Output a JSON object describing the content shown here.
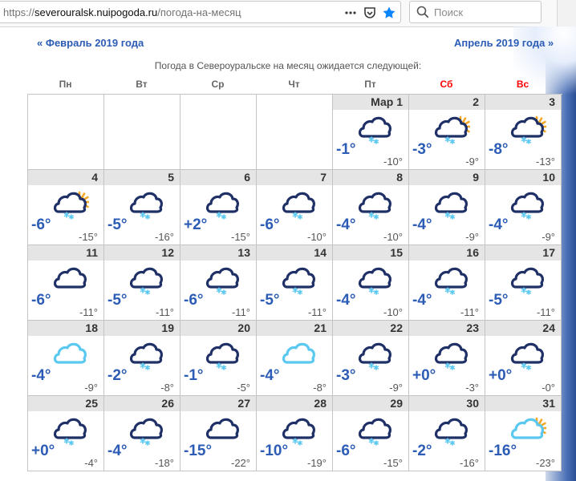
{
  "browser": {
    "url_prefix": "https://",
    "url_domain": "severouralsk.nuipogoda.ru",
    "url_path": "/погода-на-месяц",
    "search_placeholder": "Поиск"
  },
  "nav": {
    "prev_label": "« Февраль 2019 года",
    "next_label": "Апрель 2019 года »"
  },
  "intro_text": "Погода в Североуральске на месяц ожидается следующей:",
  "weekdays": [
    {
      "label": "Пн",
      "weekend": false
    },
    {
      "label": "Вт",
      "weekend": false
    },
    {
      "label": "Ср",
      "weekend": false
    },
    {
      "label": "Чт",
      "weekend": false
    },
    {
      "label": "Пт",
      "weekend": false
    },
    {
      "label": "Сб",
      "weekend": true
    },
    {
      "label": "Вс",
      "weekend": true
    }
  ],
  "colors": {
    "link": "#2c5cb5",
    "weekend": "#ff0000",
    "cloud_dark": "#1f3066",
    "cloud_light": "#5bc8f0",
    "snow": "#5bc8f0",
    "sun": "#f5a623"
  },
  "days": [
    {
      "label": "",
      "icon": null,
      "day": "",
      "night": ""
    },
    {
      "label": "",
      "icon": null,
      "day": "",
      "night": ""
    },
    {
      "label": "",
      "icon": null,
      "day": "",
      "night": ""
    },
    {
      "label": "",
      "icon": null,
      "day": "",
      "night": ""
    },
    {
      "label": "Мар  1",
      "icon": "cloud-snow-icon",
      "day": "-1°",
      "night": "-10°"
    },
    {
      "label": "2",
      "icon": "sun-cloud-snow-icon",
      "day": "-3°",
      "night": "-9°"
    },
    {
      "label": "3",
      "icon": "sun-cloud-snow-icon",
      "day": "-8°",
      "night": "-13°"
    },
    {
      "label": "4",
      "icon": "sun-cloud-snow-icon",
      "day": "-6°",
      "night": "-15°"
    },
    {
      "label": "5",
      "icon": "cloud-snow-icon",
      "day": "-5°",
      "night": "-16°"
    },
    {
      "label": "6",
      "icon": "cloud-snow-icon",
      "day": "+2°",
      "night": "-15°"
    },
    {
      "label": "7",
      "icon": "cloud-snow-icon",
      "day": "-6°",
      "night": "-10°"
    },
    {
      "label": "8",
      "icon": "cloud-snow-icon",
      "day": "-4°",
      "night": "-10°"
    },
    {
      "label": "9",
      "icon": "cloud-snow-icon",
      "day": "-4°",
      "night": "-9°"
    },
    {
      "label": "10",
      "icon": "cloud-snow-icon",
      "day": "-4°",
      "night": "-9°"
    },
    {
      "label": "11",
      "icon": "cloud-icon",
      "day": "-6°",
      "night": "-11°"
    },
    {
      "label": "12",
      "icon": "cloud-snow-icon",
      "day": "-5°",
      "night": "-11°"
    },
    {
      "label": "13",
      "icon": "cloud-snow-icon",
      "day": "-6°",
      "night": "-11°"
    },
    {
      "label": "14",
      "icon": "cloud-snow-icon",
      "day": "-5°",
      "night": "-11°"
    },
    {
      "label": "15",
      "icon": "cloud-snow-icon",
      "day": "-4°",
      "night": "-10°"
    },
    {
      "label": "16",
      "icon": "cloud-snow-icon",
      "day": "-4°",
      "night": "-11°"
    },
    {
      "label": "17",
      "icon": "cloud-snow-icon",
      "day": "-5°",
      "night": "-11°"
    },
    {
      "label": "18",
      "icon": "light-cloud-icon",
      "day": "-4°",
      "night": "-9°"
    },
    {
      "label": "19",
      "icon": "cloud-snow-icon",
      "day": "-2°",
      "night": "-8°"
    },
    {
      "label": "20",
      "icon": "cloud-snow-icon",
      "day": "-1°",
      "night": "-5°"
    },
    {
      "label": "21",
      "icon": "light-cloud-icon",
      "day": "-4°",
      "night": "-8°"
    },
    {
      "label": "22",
      "icon": "cloud-snow-icon",
      "day": "-3°",
      "night": "-9°"
    },
    {
      "label": "23",
      "icon": "cloud-snow-icon",
      "day": "+0°",
      "night": "-3°"
    },
    {
      "label": "24",
      "icon": "cloud-snow-icon",
      "day": "+0°",
      "night": "-0°"
    },
    {
      "label": "25",
      "icon": "cloud-snow-icon",
      "day": "+0°",
      "night": "-4°"
    },
    {
      "label": "26",
      "icon": "cloud-snow-icon",
      "day": "-4°",
      "night": "-18°"
    },
    {
      "label": "27",
      "icon": "cloud-icon",
      "day": "-15°",
      "night": "-22°"
    },
    {
      "label": "28",
      "icon": "cloud-snow-icon",
      "day": "-10°",
      "night": "-19°"
    },
    {
      "label": "29",
      "icon": "cloud-snow-icon",
      "day": "-6°",
      "night": "-15°"
    },
    {
      "label": "30",
      "icon": "cloud-snow-icon",
      "day": "-2°",
      "night": "-16°"
    },
    {
      "label": "31",
      "icon": "sun-light-cloud-icon",
      "day": "-16°",
      "night": "-23°"
    }
  ]
}
